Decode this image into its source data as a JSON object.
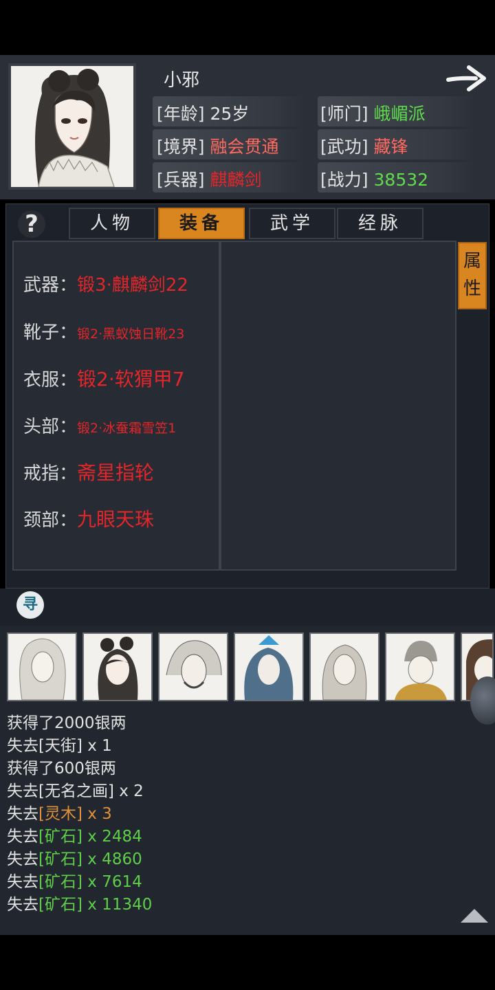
{
  "character": {
    "name": "小邪",
    "stats_left": [
      {
        "label": "[年龄]",
        "value": "25岁",
        "color": "#e4e4e4"
      },
      {
        "label": "[境界]",
        "value": "融会贯通",
        "color": "#ff6a60"
      },
      {
        "label": "[兵器]",
        "value": "麒麟剑",
        "color": "#e3262a"
      }
    ],
    "stats_right": [
      {
        "label": "[师门]",
        "value": "峨嵋派",
        "color": "#5fdc4c"
      },
      {
        "label": "[武功]",
        "value": "藏锋",
        "color": "#ff6a60"
      },
      {
        "label": "[战力]",
        "value": "38532",
        "color": "#5fdc4c"
      }
    ]
  },
  "tabs": [
    {
      "label": "人物",
      "active": false
    },
    {
      "label": "装备",
      "active": true
    },
    {
      "label": "武学",
      "active": false
    },
    {
      "label": "经脉",
      "active": false
    }
  ],
  "help_icon": "?",
  "attr_tab": {
    "line1": "属",
    "line2": "性"
  },
  "equipment": [
    {
      "slot": "武器：",
      "item": "锻3·麒麟剑22"
    },
    {
      "slot": "靴子：",
      "item": "锻2·黑蚁蚀日靴23"
    },
    {
      "slot": "衣服：",
      "item": "锻2·软猬甲7"
    },
    {
      "slot": "头部：",
      "item": "锻2·冰蚕霜雪笠1"
    },
    {
      "slot": "戒指：",
      "item": "斋星指轮"
    },
    {
      "slot": "颈部：",
      "item": "九眼天珠"
    }
  ],
  "search_icon": "寻",
  "log": [
    {
      "prefix": "获得了2000银两",
      "item": "",
      "suffix": "",
      "color": ""
    },
    {
      "prefix": "失去",
      "item": "[天街]",
      "suffix": " x 1",
      "color": ""
    },
    {
      "prefix": "获得了600银两",
      "item": "",
      "suffix": "",
      "color": ""
    },
    {
      "prefix": "失去",
      "item": "[无名之画]",
      "suffix": " x 2",
      "color": ""
    },
    {
      "prefix": "失去",
      "item": "[灵木]",
      "suffix": " x 3",
      "color": "o"
    },
    {
      "prefix": "失去",
      "item": "[矿石]",
      "suffix": " x 2484",
      "color": "g"
    },
    {
      "prefix": "失去",
      "item": "[矿石]",
      "suffix": " x 4860",
      "color": "g"
    },
    {
      "prefix": "失去",
      "item": "[矿石]",
      "suffix": " x 7614",
      "color": "g"
    },
    {
      "prefix": "失去",
      "item": "[矿石]",
      "suffix": " x 11340",
      "color": "g"
    }
  ]
}
